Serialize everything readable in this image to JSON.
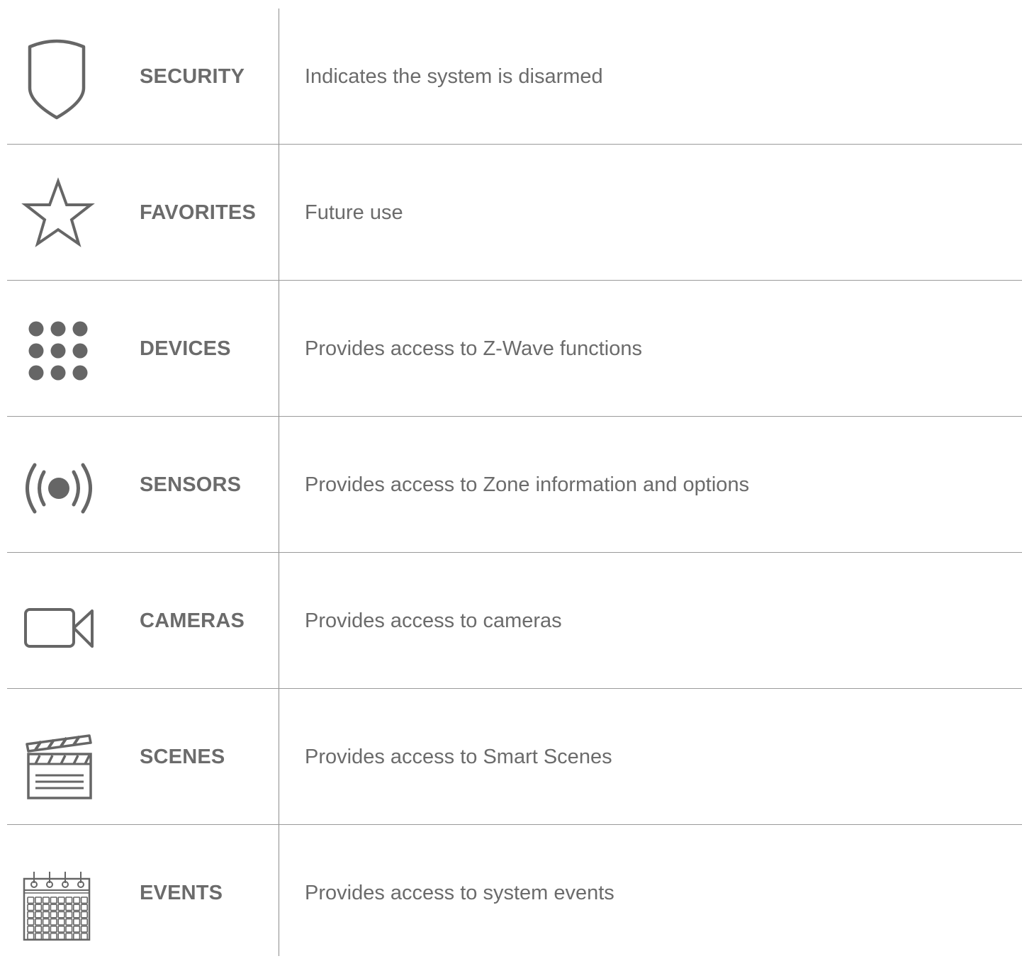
{
  "items": [
    {
      "name": "SECURITY",
      "description": "Indicates the system is disarmed",
      "icon": "shield-icon"
    },
    {
      "name": "FAVORITES",
      "description": "Future use",
      "icon": "star-icon"
    },
    {
      "name": "DEVICES",
      "description": "Provides access to Z-Wave functions",
      "icon": "grid-dots-icon"
    },
    {
      "name": "SENSORS",
      "description": "Provides access to Zone information and options",
      "icon": "sensor-signal-icon"
    },
    {
      "name": "CAMERAS",
      "description": "Provides access to cameras",
      "icon": "video-camera-icon"
    },
    {
      "name": "SCENES",
      "description": "Provides access to Smart Scenes",
      "icon": "clapperboard-icon"
    },
    {
      "name": "EVENTS",
      "description": "Provides access to system events",
      "icon": "calendar-icon"
    }
  ],
  "colors": {
    "text": "#6b6b6b",
    "icon": "#666666",
    "rule": "#9a9a9a"
  }
}
